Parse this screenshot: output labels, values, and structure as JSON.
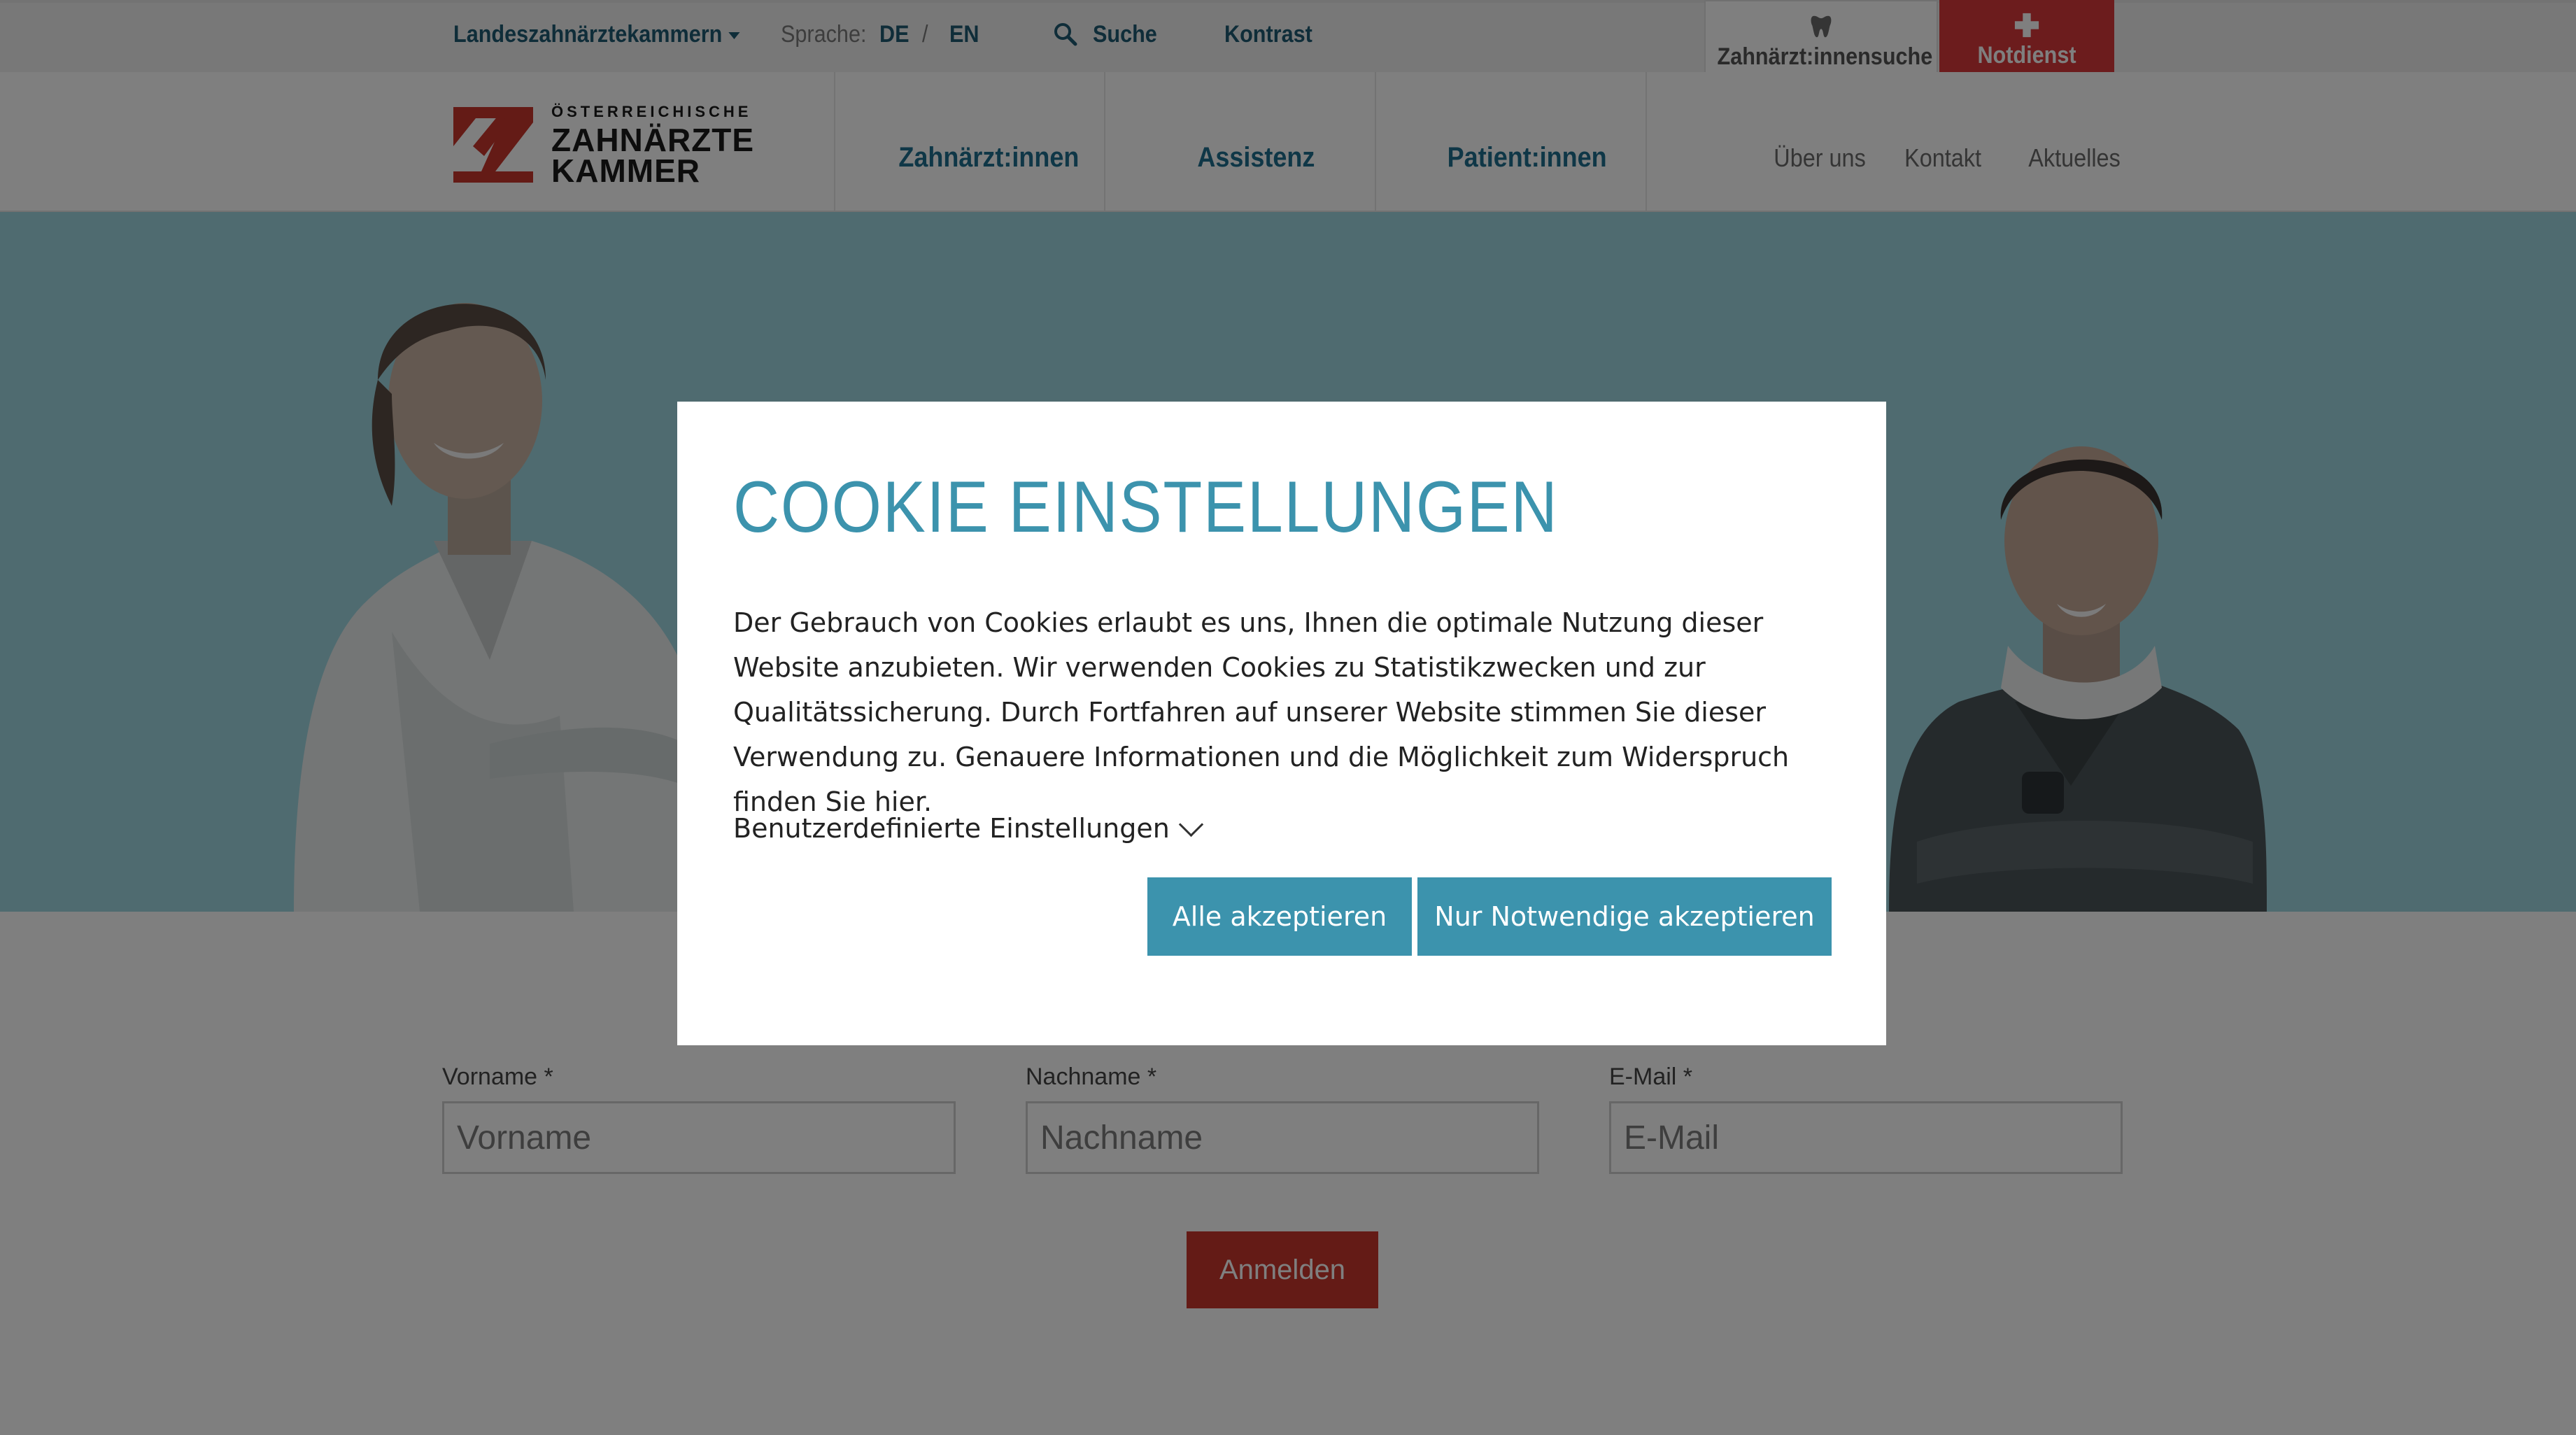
{
  "topbar": {
    "regional_chambers": "Landeszahnärztekammern",
    "language_label": "Sprache:",
    "lang_de": "DE",
    "lang_sep": "/",
    "lang_en": "EN",
    "search": "Suche",
    "contrast": "Kontrast",
    "dentist_search": "Zahnärzt:innensuche",
    "emergency": "Notdienst"
  },
  "logo": {
    "line1": "ÖSTERREICHISCHE",
    "line2": "ZAHNÄRZTE",
    "line3": "KAMMER"
  },
  "nav": {
    "main": [
      "Zahnärzt:innen",
      "Assistenz",
      "Patient:innen"
    ],
    "secondary": [
      "Über uns",
      "Kontakt",
      "Aktuelles"
    ]
  },
  "form": {
    "first_name_label": "Vorname *",
    "first_name_placeholder": "Vorname",
    "last_name_label": "Nachname *",
    "last_name_placeholder": "Nachname",
    "email_label": "E-Mail *",
    "email_placeholder": "E-Mail",
    "submit": "Anmelden"
  },
  "cookie_modal": {
    "title": "COOKIE EINSTELLUNGEN",
    "text": "Der Gebrauch von Cookies erlaubt es uns, Ihnen die optimale Nutzung dieser Website anzubieten. Wir verwenden Cookies zu Statistikzwecken und zur Qualitätssicherung. Durch Fortfahren auf unserer Website stimmen Sie dieser Verwendung zu. Genauere Informationen und die Möglichkeit zum Widerspruch finden Sie hier.",
    "custom_settings": "Benutzerdefinierte Einstellungen",
    "accept_all": "Alle akzeptieren",
    "accept_necessary": "Nur Notwendige akzeptieren"
  },
  "colors": {
    "brand_blue": "#3c93ad",
    "nav_blue": "#1f6f8e",
    "brand_red": "#d9383a",
    "hero_bg": "#9fd6e0"
  }
}
